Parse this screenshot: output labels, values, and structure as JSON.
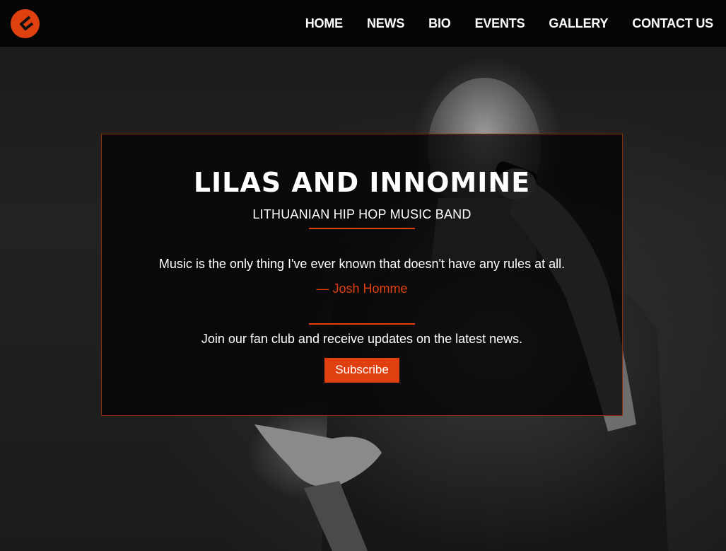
{
  "nav": {
    "items": [
      {
        "label": "HOME"
      },
      {
        "label": "NEWS"
      },
      {
        "label": "BIO"
      },
      {
        "label": "EVENTS"
      },
      {
        "label": "GALLERY"
      },
      {
        "label": "CONTACT US"
      }
    ]
  },
  "hero": {
    "title": "LILAS AND INNOMINE",
    "subtitle": "LITHUANIAN HIP HOP MUSIC BAND",
    "quote": "Music is the only thing I've ever known that doesn't have any rules at all.",
    "quote_author": "—  Josh Homme",
    "join_text": "Join our fan club and receive updates on the latest news.",
    "subscribe_label": "Subscribe"
  },
  "colors": {
    "accent": "#e0400f",
    "header_bg": "#050505"
  },
  "icons": {
    "logo": "logo-icon"
  }
}
